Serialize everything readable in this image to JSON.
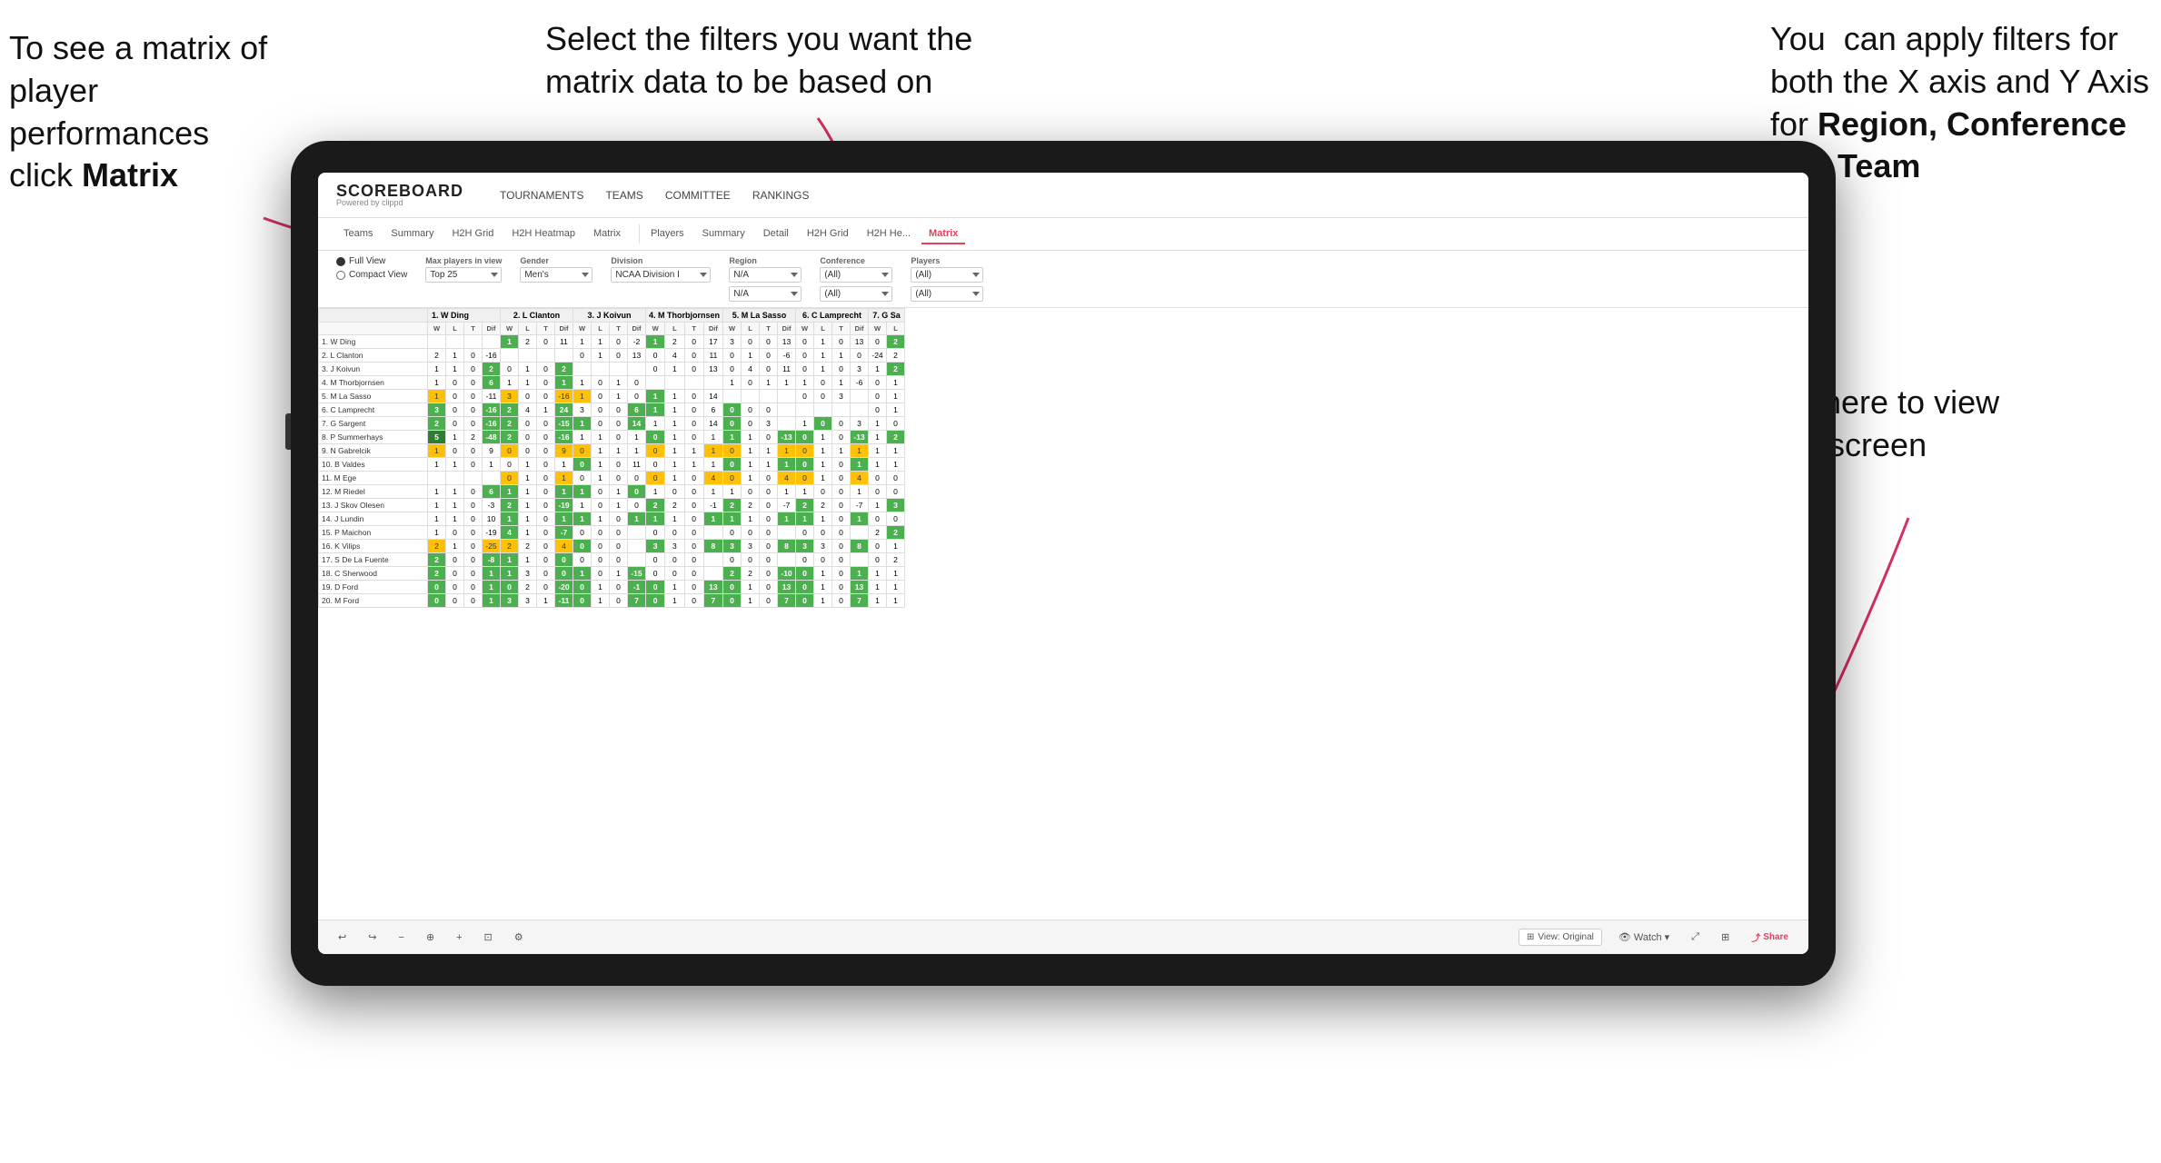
{
  "annotations": {
    "topleft_line1": "To see a matrix of",
    "topleft_line2": "player performances",
    "topleft_line3_normal": "click ",
    "topleft_line3_bold": "Matrix",
    "topcenter": "Select the filters you want the matrix data to be based on",
    "topright_line1": "You  can apply filters for both the X axis and Y Axis for ",
    "topright_bold": "Region, Conference and Team",
    "bottomright_line1": "Click here to view in full screen"
  },
  "app": {
    "logo_title": "SCOREBOARD",
    "logo_subtitle": "Powered by clippd",
    "nav": [
      "TOURNAMENTS",
      "TEAMS",
      "COMMITTEE",
      "RANKINGS"
    ],
    "subnav_players": [
      "Teams",
      "Summary",
      "H2H Grid",
      "H2H Heatmap",
      "Matrix",
      "Players",
      "Summary",
      "Detail",
      "H2H Grid",
      "H2H He...",
      "Matrix"
    ],
    "active_tab": "Matrix"
  },
  "filters": {
    "view_options": [
      "Full View",
      "Compact View"
    ],
    "active_view": "Full View",
    "max_players_label": "Max players in view",
    "max_players_value": "Top 25",
    "gender_label": "Gender",
    "gender_value": "Men's",
    "division_label": "Division",
    "division_value": "NCAA Division I",
    "region_label": "Region",
    "region_value": "N/A",
    "region_value2": "N/A",
    "conference_label": "Conference",
    "conference_value": "(All)",
    "conference_value2": "(All)",
    "players_label": "Players",
    "players_value": "(All)",
    "players_value2": "(All)"
  },
  "matrix": {
    "column_players": [
      "1. W Ding",
      "2. L Clanton",
      "3. J Koivun",
      "4. M Thorbjornsen",
      "5. M La Sasso",
      "6. C Lamprecht",
      "7. G Sa"
    ],
    "row_players": [
      "1. W Ding",
      "2. L Clanton",
      "3. J Koivun",
      "4. M Thorbjornsen",
      "5. M La Sasso",
      "6. C Lamprecht",
      "7. G Sargent",
      "8. P Summerhays",
      "9. N Gabrelcik",
      "10. B Valdes",
      "11. M Ege",
      "12. M Riedel",
      "13. J Skov Olesen",
      "14. J Lundin",
      "15. P Maichon",
      "16. K Vilips",
      "17. S De La Fuente",
      "18. C Sherwood",
      "19. D Ford",
      "20. M Ford"
    ],
    "sub_headers": [
      "W",
      "L",
      "T",
      "Dif"
    ]
  },
  "toolbar": {
    "view_original": "View: Original",
    "watch": "Watch",
    "share": "Share"
  },
  "colors": {
    "accent": "#e83e5a",
    "arrow": "#d63060"
  }
}
